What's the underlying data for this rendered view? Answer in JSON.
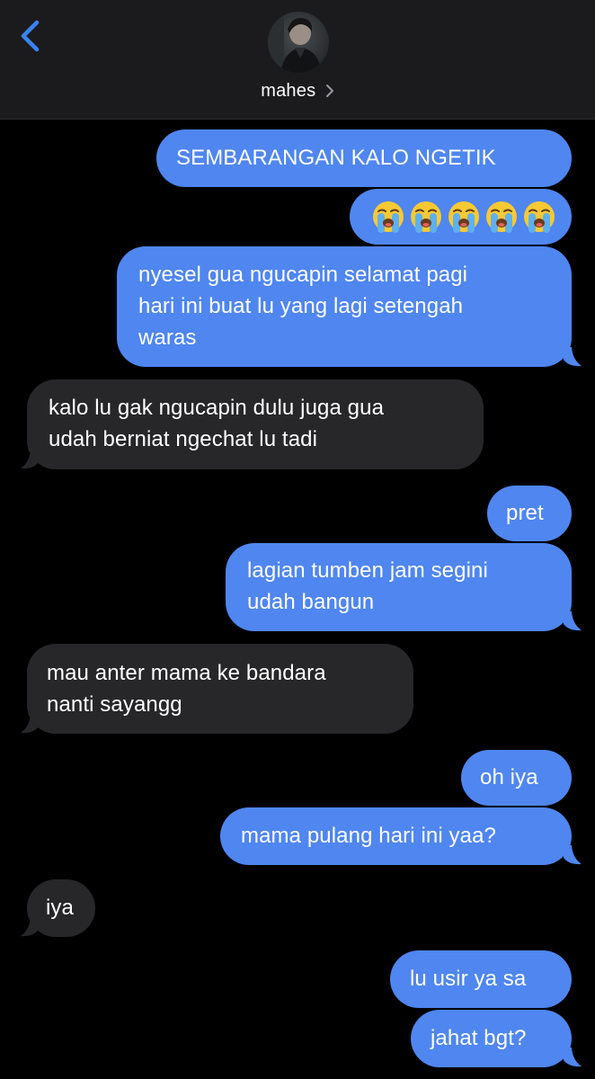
{
  "header": {
    "contact_name": "mahes",
    "back_icon": "chevron-left-icon",
    "disclosure_icon": "chevron-right-icon"
  },
  "colors": {
    "outgoing_bubble": "#4f86f0",
    "incoming_bubble": "#272729",
    "accent": "#3b82f6",
    "background": "#000000",
    "header_bg": "#1b1b1d"
  },
  "messages": [
    {
      "direction": "outgoing",
      "text": "SEMBARANGAN KALO NGETIK"
    },
    {
      "direction": "outgoing",
      "emoji": "loudly-crying-face",
      "count": 5
    },
    {
      "direction": "outgoing",
      "lines": [
        "nyesel gua ngucapin selamat pagi",
        "hari ini buat lu yang lagi setengah",
        "waras"
      ]
    },
    {
      "direction": "incoming",
      "lines": [
        "kalo lu gak ngucapin dulu juga gua",
        "udah berniat ngechat lu tadi"
      ]
    },
    {
      "direction": "outgoing",
      "text": "pret"
    },
    {
      "direction": "outgoing",
      "lines": [
        "lagian tumben jam segini",
        "udah bangun"
      ]
    },
    {
      "direction": "incoming",
      "lines": [
        "mau anter mama ke bandara",
        "nanti sayangg"
      ]
    },
    {
      "direction": "outgoing",
      "text": "oh iya"
    },
    {
      "direction": "outgoing",
      "text": "mama pulang hari ini yaa?"
    },
    {
      "direction": "incoming",
      "text": "iya"
    },
    {
      "direction": "outgoing",
      "text": "lu usir ya sa"
    },
    {
      "direction": "outgoing",
      "text": "jahat bgt?"
    }
  ]
}
